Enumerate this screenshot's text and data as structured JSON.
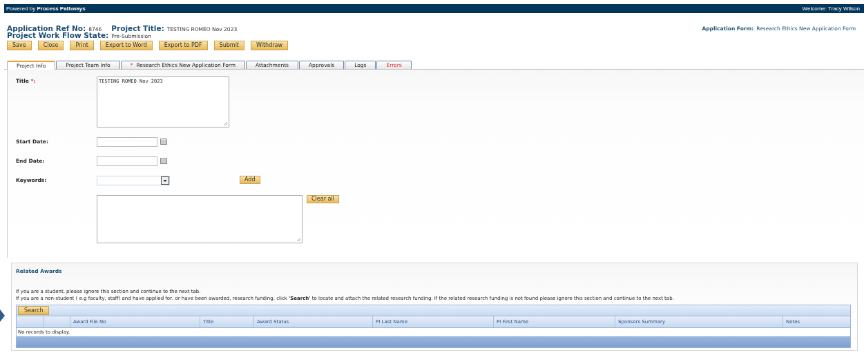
{
  "top_bar": {
    "powered_by": "Powered by",
    "brand": "Process Pathways",
    "welcome": "Welcome: Tracy Wilson"
  },
  "header": {
    "fields": [
      {
        "label": "Application Ref No:",
        "value": "8746"
      },
      {
        "label": "Project Title:",
        "value": "TESTING ROMEO Nov 2023"
      }
    ],
    "workflow": {
      "label": "Project Work Flow State:",
      "value": "Pre-Submission"
    },
    "application_form": {
      "label": "Application Form:",
      "value": "Research Ethics New Application Form"
    }
  },
  "toolbar": [
    "Save",
    "Close",
    "Print",
    "Export to Word",
    "Export to PDF",
    "Submit",
    "Withdraw"
  ],
  "tabs": [
    {
      "label": "Project Info",
      "selected": true,
      "kind": "normal"
    },
    {
      "label": "Project Team Info",
      "selected": false,
      "kind": "normal"
    },
    {
      "label": "Research Ethics New Application Form",
      "selected": false,
      "kind": "required",
      "marker": "*"
    },
    {
      "label": "Attachments",
      "selected": false,
      "kind": "normal"
    },
    {
      "label": "Approvals",
      "selected": false,
      "kind": "normal"
    },
    {
      "label": "Logs",
      "selected": false,
      "kind": "normal"
    },
    {
      "label": "Errors",
      "selected": false,
      "kind": "error"
    }
  ],
  "form": {
    "fields": [
      {
        "kind": "textarea",
        "label": "Title",
        "required_mark": "*:",
        "value": "TESTING ROMEO Nov 2023"
      },
      {
        "kind": "date",
        "label": "Start Date:"
      },
      {
        "kind": "date",
        "label": "End Date:"
      },
      {
        "kind": "combo",
        "label": "Keywords:",
        "button": "Add"
      },
      {
        "kind": "list",
        "button": "Clear all"
      }
    ]
  },
  "related_awards": {
    "title": "Related Awards",
    "notes": [
      "If you are a student, please ignore this section and continue to the next tab.",
      "If you are a non-student ( e.g faculty, staff) and have applied for, or have been awarded, research funding, click **'Search'** to locate and attach the related research funding. If the related research funding is not found please ignore this section and continue to the next tab."
    ],
    "search_button": "Search",
    "columns": [
      "Award File No",
      "Title",
      "Award Status",
      "PI Last Name",
      "PI First Name",
      "Sponsors Summary",
      "Notes"
    ],
    "empty_message": "No records to display."
  }
}
